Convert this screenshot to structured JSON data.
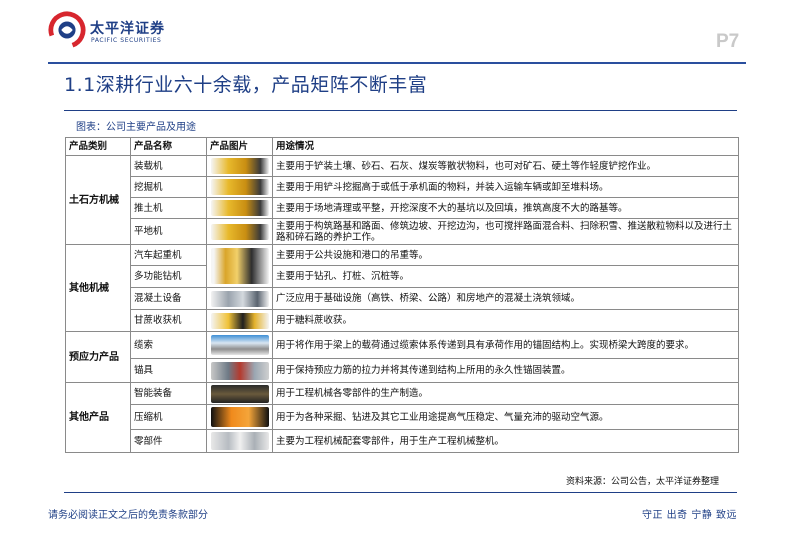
{
  "header": {
    "logo_cn": "太平洋证券",
    "logo_en": "PACIFIC SECURITIES",
    "page_number": "P7"
  },
  "title": "1.1深耕行业六十余载，产品矩阵不断丰富",
  "caption": "图表：公司主要产品及用途",
  "table": {
    "headers": [
      "产品类别",
      "产品名称",
      "产品图片",
      "用途情况"
    ],
    "groups": [
      {
        "category": "土石方机械",
        "rows": [
          {
            "name": "装载机",
            "image": "loader-photo",
            "use": "主要用于铲装土壤、砂石、石灰、煤炭等散状物料，也可对矿石、硬土等作轻度铲挖作业。"
          },
          {
            "name": "挖掘机",
            "image": "excavator-photo",
            "use": "主要用于用铲斗挖掘高于或低于承机面的物料，并装入运输车辆或卸至堆料场。"
          },
          {
            "name": "推土机",
            "image": "bulldozer-photo",
            "use": "主要用于场地清理或平整，开挖深度不大的基坑以及回填，推筑高度不大的路基等。"
          },
          {
            "name": "平地机",
            "image": "grader-photo",
            "use": "主要用于构筑路基和路面、修筑边坡、开挖边沟，也可搅拌路面混合料、扫除积雪、推送散粒物料以及进行土路和碎石路的养护工作。"
          }
        ]
      },
      {
        "category": "其他机械",
        "rows": [
          {
            "name": "汽车起重机",
            "image": "truck-crane-photo",
            "use": "主要用于公共设施和港口的吊重等。"
          },
          {
            "name": "多功能钻机",
            "image": "drilling-rig-photo",
            "use": "主要用于钻孔、打桩、沉桩等。"
          },
          {
            "name": "混凝土设备",
            "image": "concrete-equipment-photo",
            "use": "广泛应用于基础设施（高铁、桥梁、公路）和房地产的混凝土浇筑领域。"
          },
          {
            "name": "甘蔗收获机",
            "image": "sugarcane-harvester-photo",
            "use": "用于糖料蔗收获。"
          }
        ]
      },
      {
        "category": "预应力产品",
        "rows": [
          {
            "name": "缆索",
            "image": "cable-photo",
            "use": "用于将作用于梁上的载荷通过缆索体系传递到具有承荷作用的锚固结构上。实现桥梁大跨度的要求。"
          },
          {
            "name": "锚具",
            "image": "anchor-photo",
            "use": "用于保持预应力筋的拉力并将其传递到结构上所用的永久性锚固装置。"
          }
        ]
      },
      {
        "category": "其他产品",
        "rows": [
          {
            "name": "智能装备",
            "image": "smart-equipment-photo",
            "use": "用于工程机械各零部件的生产制造。"
          },
          {
            "name": "压缩机",
            "image": "compressor-photo",
            "use": "用于为各种采掘、钻进及其它工业用途提高气压稳定、气量充沛的驱动空气源。"
          },
          {
            "name": "零部件",
            "image": "parts-photo",
            "use": "主要为工程机械配套零部件，用于生产工程机械整机。"
          }
        ]
      }
    ]
  },
  "source": "资料来源：公司公告，太平洋证券整理",
  "footer": {
    "disclaimer": "请务必阅读正文之后的免责条款部分",
    "motto": "守正  出奇  宁静  致远"
  },
  "colors": {
    "brand_blue": "#1f3f86",
    "brand_red": "#d7262e"
  }
}
